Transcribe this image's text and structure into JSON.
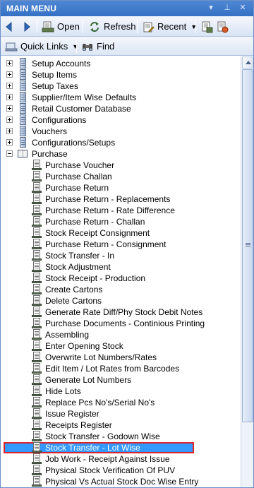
{
  "window": {
    "title": "MAIN MENU"
  },
  "toolbar": {
    "open_label": "Open",
    "refresh_label": "Refresh",
    "recent_label": "Recent"
  },
  "toolbar2": {
    "quick_links_label": "Quick Links",
    "find_label": "Find"
  },
  "tree": {
    "top_nodes": [
      {
        "label": "Setup Accounts",
        "expanded": false
      },
      {
        "label": "Setup Items",
        "expanded": false
      },
      {
        "label": "Setup Taxes",
        "expanded": false
      },
      {
        "label": "Supplier/Item Wise Defaults",
        "expanded": false
      },
      {
        "label": "Retail Customer Database",
        "expanded": false
      },
      {
        "label": "Configurations",
        "expanded": false
      },
      {
        "label": "Vouchers",
        "expanded": false
      },
      {
        "label": "Configurations/Setups",
        "expanded": false
      },
      {
        "label": "Purchase",
        "expanded": true
      }
    ],
    "purchase_children": [
      "Purchase Voucher",
      "Purchase Challan",
      "Purchase Return",
      "Purchase Return - Replacements",
      "Purchase Return - Rate Difference",
      "Purchase Return - Challan",
      "Stock Receipt Consignment",
      "Purchase Return - Consignment",
      "Stock Transfer - In",
      "Stock Adjustment",
      "Stock Receipt - Production",
      "Create Cartons",
      "Delete Cartons",
      "Generate Rate Diff/Phy Stock Debit Notes",
      "Purchase Documents - Continious Printing",
      "Assembling",
      "Enter Opening Stock",
      "Overwrite Lot Numbers/Rates",
      "Edit Item / Lot Rates from Barcodes",
      "Generate Lot Numbers",
      "Hide Lots",
      "Replace Pcs No's/Serial No's",
      "Issue Register",
      "Receipts Register",
      "Stock Transfer - Godown Wise",
      "Stock Transfer - Lot Wise",
      "Job Work - Receipt Against Issue",
      "Physical Stock Verification Of PUV",
      "Physical Vs Actual Stock Doc Wise Entry"
    ],
    "selected_item": "Stock Transfer - Lot Wise"
  },
  "colors": {
    "title_bar": "#3f7bcb",
    "selection": "#3399ff",
    "selection_outline": "#e0242c"
  }
}
